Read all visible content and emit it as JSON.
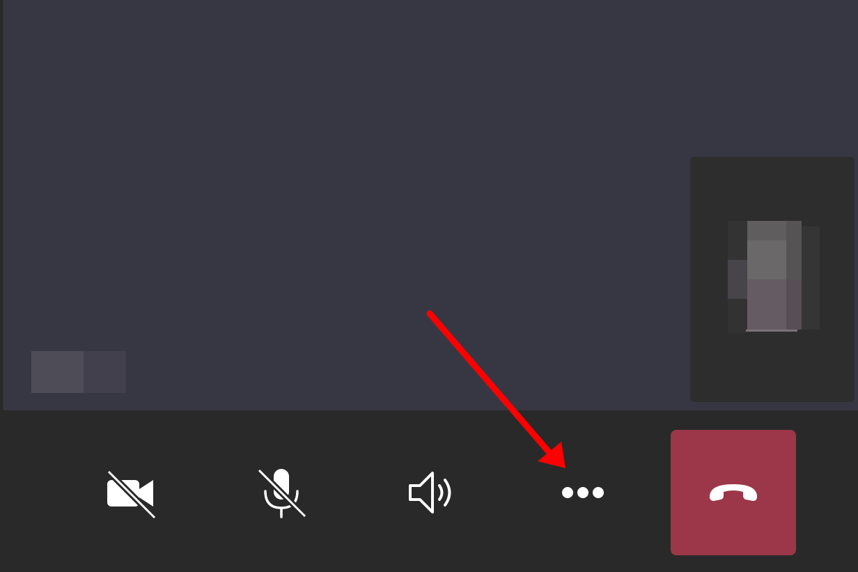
{
  "call": {
    "remote_participant": {
      "name_tag": ""
    },
    "self_view": {
      "label": ""
    }
  },
  "controls": [
    {
      "id": "camera",
      "icon": "camera-off-icon",
      "state": "off"
    },
    {
      "id": "microphone",
      "icon": "mic-off-icon",
      "state": "muted"
    },
    {
      "id": "speaker",
      "icon": "speaker-icon",
      "state": "on"
    },
    {
      "id": "more",
      "icon": "more-options-icon"
    },
    {
      "id": "hangup",
      "icon": "hang-up-icon",
      "color": "#9b3748"
    }
  ],
  "annotation": {
    "type": "arrow",
    "color": "#ff0000",
    "target": "more-options-button"
  },
  "colors": {
    "stage": "#373743",
    "bar": "#292929",
    "self_view": "#2d2d2d",
    "hangup": "#9b3748"
  }
}
